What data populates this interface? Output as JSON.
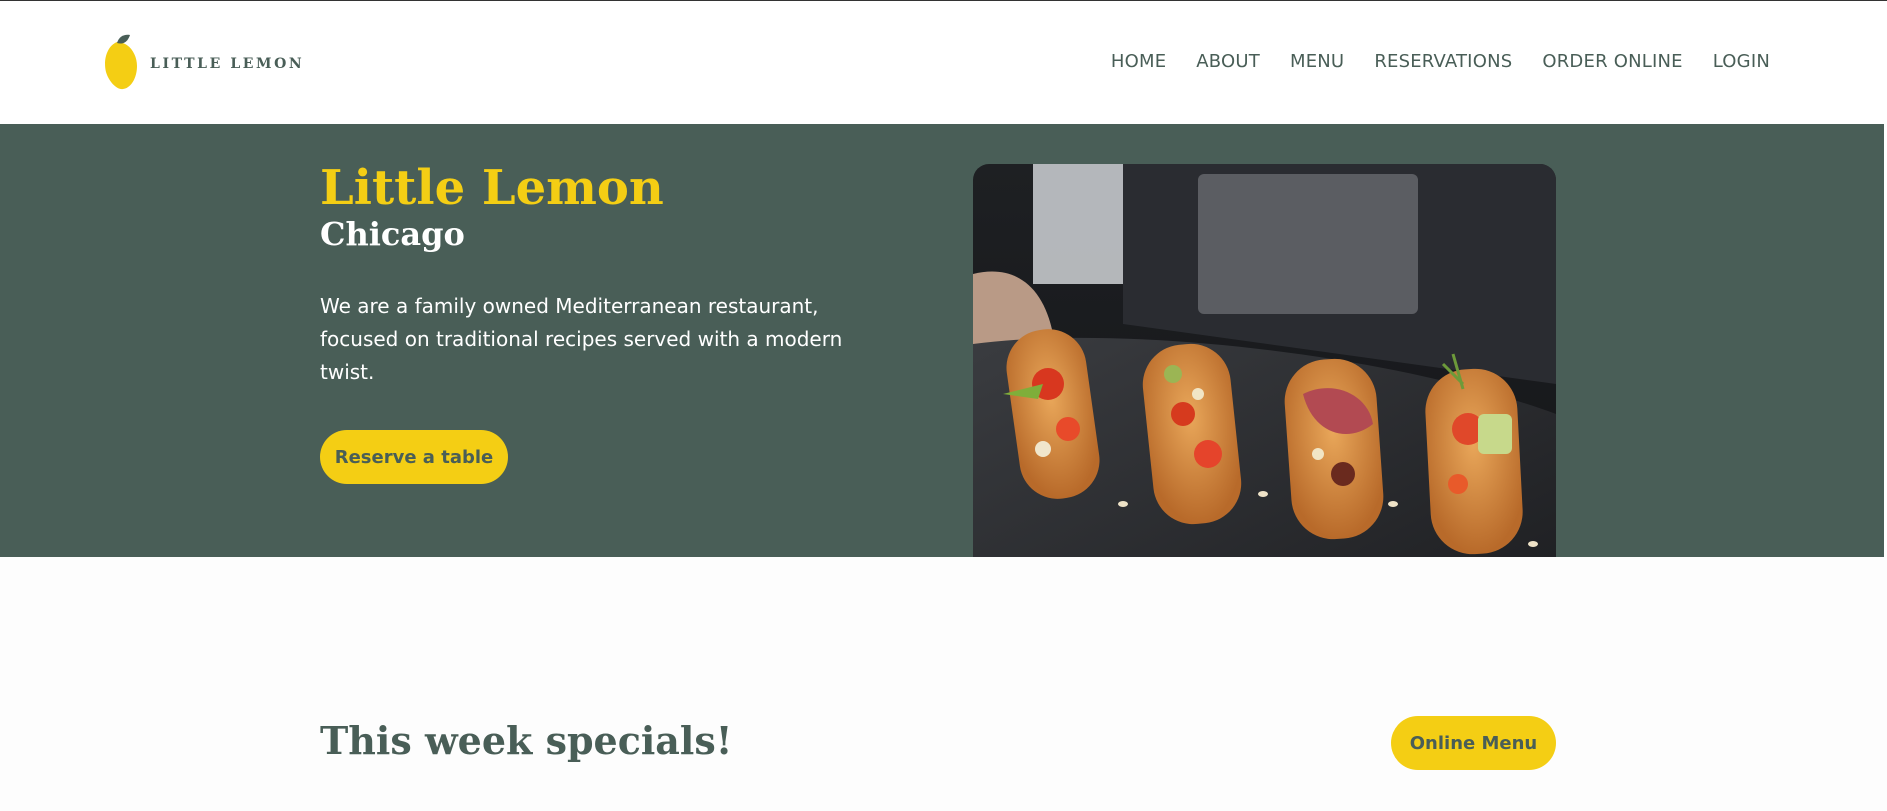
{
  "brand": {
    "logo_text": "LITTLE LEMON",
    "logo_icon": "lemon-icon"
  },
  "nav": {
    "items": [
      {
        "label": "HOME"
      },
      {
        "label": "ABOUT"
      },
      {
        "label": "MENU"
      },
      {
        "label": "RESERVATIONS"
      },
      {
        "label": "ORDER ONLINE"
      },
      {
        "label": "LOGIN"
      }
    ]
  },
  "hero": {
    "title": "Little Lemon",
    "subtitle": "Chicago",
    "description": "We are a family owned Mediterranean restaurant, focused on traditional recipes served with a modern twist.",
    "cta_label": "Reserve a table",
    "image": "bruschetta-platter-photo"
  },
  "specials": {
    "title": "This week specials!",
    "cta_label": "Online Menu"
  },
  "colors": {
    "primary_green": "#495e57",
    "primary_yellow": "#f4ce14",
    "white": "#ffffff"
  }
}
